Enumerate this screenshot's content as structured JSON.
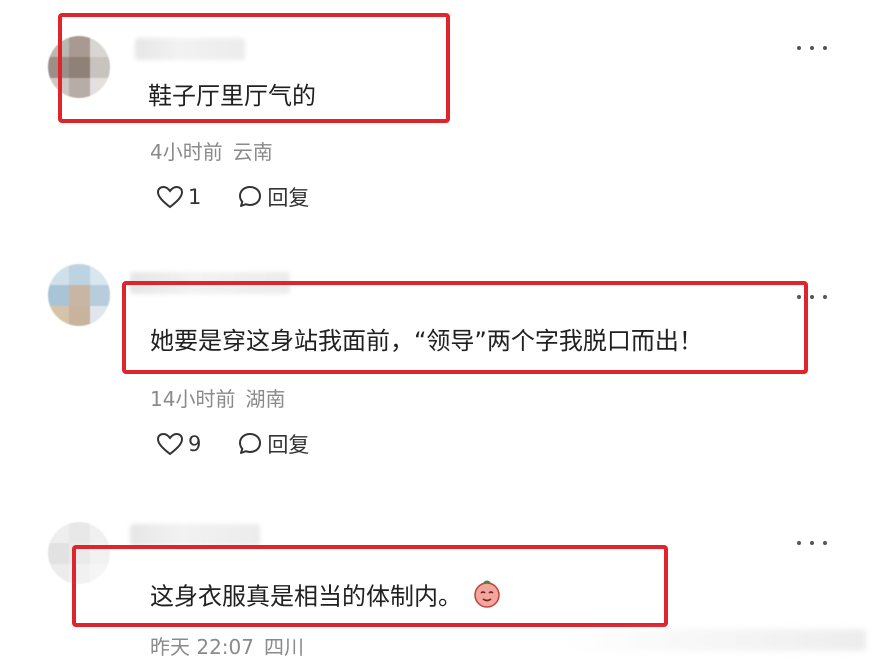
{
  "comments": [
    {
      "text": "鞋子厅里厅气的",
      "time": "4小时前",
      "region": "云南",
      "likes": "1",
      "reply_label": "回复"
    },
    {
      "text": "她要是穿这身站我面前，“领导”两个字我脱口而出！",
      "time": "14小时前",
      "region": "湖南",
      "likes": "9",
      "reply_label": "回复"
    },
    {
      "text": "这身衣服真是相当的体制内。",
      "time": "昨天 22:07",
      "region": "四川",
      "emoji": "doge-face-emoji"
    }
  ],
  "colors": {
    "highlight": "#e0242c",
    "meta_text": "#8a8a8a"
  },
  "icons": [
    "heart-icon",
    "comment-bubble-icon",
    "more-dots-icon"
  ]
}
